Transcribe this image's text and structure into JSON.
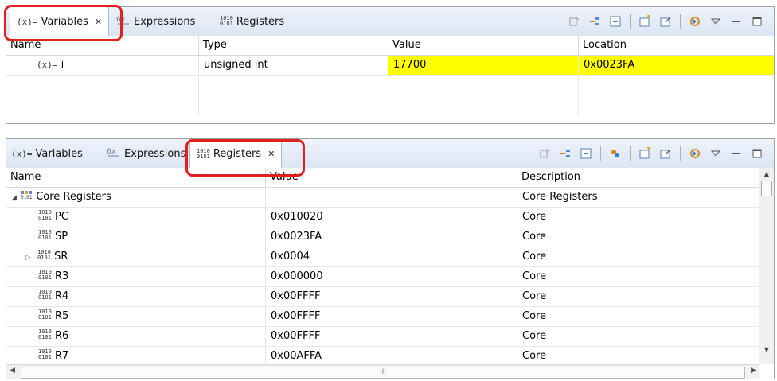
{
  "top_panel": {
    "tabs": [
      {
        "icon": "variables-icon",
        "glyph": "(x)=",
        "label": "Variables",
        "active": true
      },
      {
        "icon": "expressions-icon",
        "label": "Expressions",
        "active": false
      },
      {
        "icon": "registers-icon",
        "label": "Registers",
        "active": false
      }
    ],
    "columns": [
      "Name",
      "Type",
      "Value",
      "Location"
    ],
    "rows": [
      {
        "glyph": "(x)=",
        "name": "i",
        "type": "unsigned int",
        "value": "17700",
        "location": "0x0023FA",
        "highlight_color": "#ffff00"
      }
    ]
  },
  "bottom_panel": {
    "tabs": [
      {
        "icon": "variables-icon",
        "glyph": "(x)=",
        "label": "Variables",
        "active": false
      },
      {
        "icon": "expressions-icon",
        "label": "Expressions",
        "active": false
      },
      {
        "icon": "registers-icon",
        "label": "Registers",
        "active": true
      }
    ],
    "columns": [
      "Name",
      "Value",
      "Description"
    ],
    "group": {
      "name": "Core Registers",
      "description": "Core Registers",
      "expanded": true
    },
    "rows": [
      {
        "name": "PC",
        "value": "0x010020",
        "description": "Core",
        "expandable": false
      },
      {
        "name": "SP",
        "value": "0x0023FA",
        "description": "Core",
        "expandable": false
      },
      {
        "name": "SR",
        "value": "0x0004",
        "description": "Core",
        "expandable": true
      },
      {
        "name": "R3",
        "value": "0x000000",
        "description": "Core",
        "expandable": false
      },
      {
        "name": "R4",
        "value": "0x00FFFF",
        "description": "Core",
        "expandable": false
      },
      {
        "name": "R5",
        "value": "0x00FFFF",
        "description": "Core",
        "expandable": false
      },
      {
        "name": "R6",
        "value": "0x00FFFF",
        "description": "Core",
        "expandable": false
      },
      {
        "name": "R7",
        "value": "0x00AFFA",
        "description": "Core",
        "expandable": false
      }
    ],
    "scrollbar_h_grip": "III"
  },
  "colors": {
    "annotation": "#e01f1f",
    "highlight": "#ffff00",
    "tab_bar": "#dbe5f3"
  }
}
